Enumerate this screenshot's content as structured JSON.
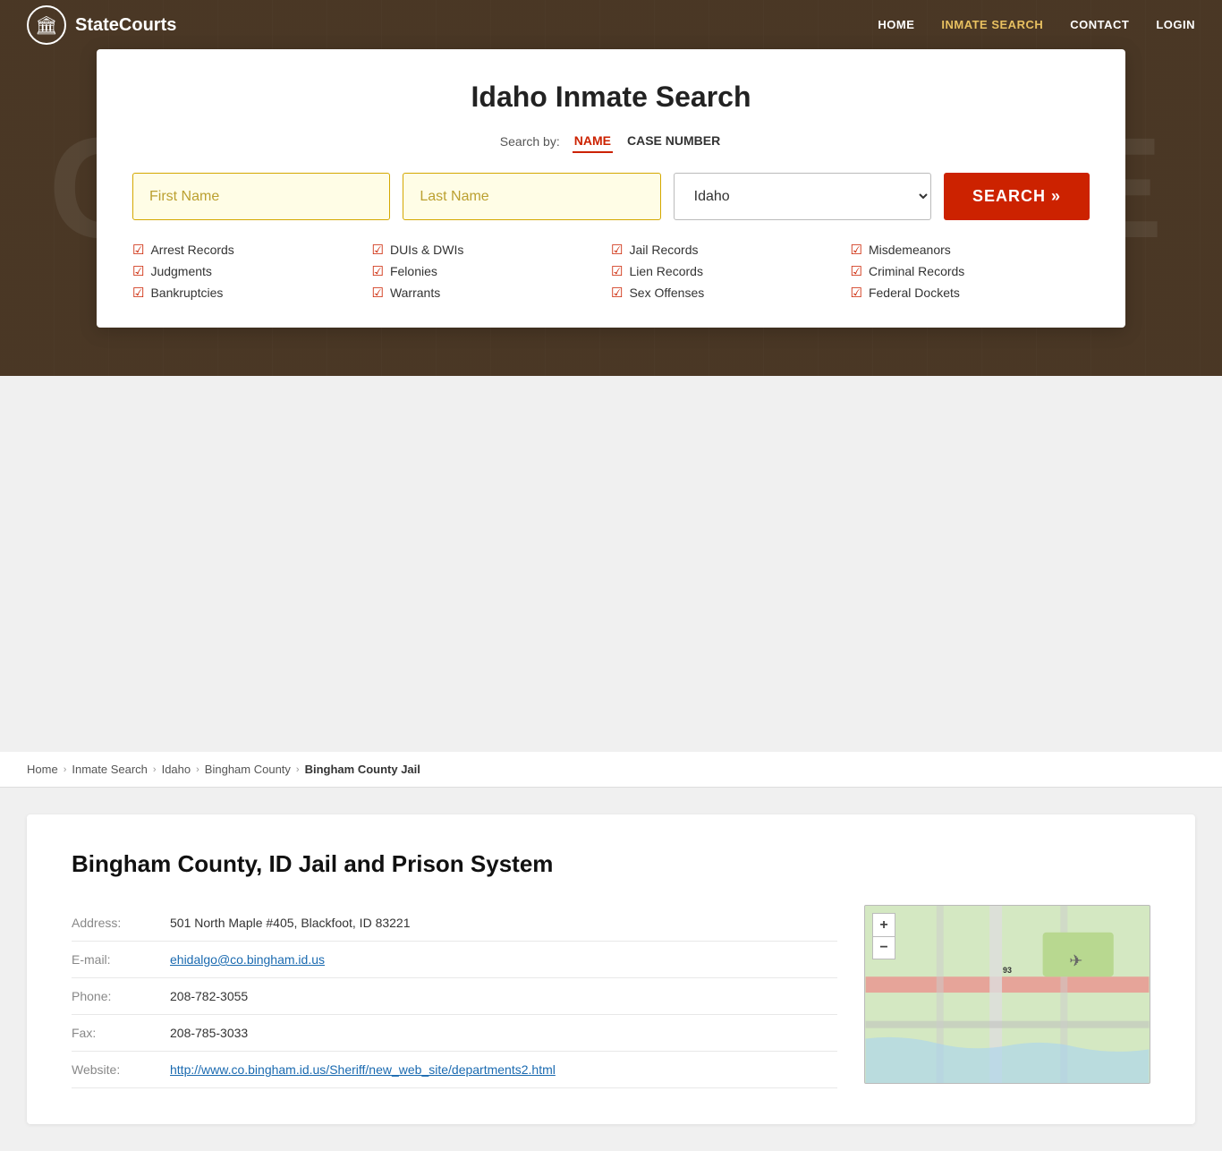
{
  "nav": {
    "logo_text": "StateCourts",
    "logo_icon": "🏛",
    "links": [
      {
        "label": "HOME",
        "href": "#",
        "active": false
      },
      {
        "label": "INMATE SEARCH",
        "href": "#",
        "active": true
      },
      {
        "label": "CONTACT",
        "href": "#",
        "active": false
      },
      {
        "label": "LOGIN",
        "href": "#",
        "active": false
      }
    ]
  },
  "hero": {
    "bg_text": "COURTHOUSE"
  },
  "search_card": {
    "title": "Idaho Inmate Search",
    "search_by_label": "Search by:",
    "tabs": [
      {
        "label": "NAME",
        "active": true
      },
      {
        "label": "CASE NUMBER",
        "active": false
      }
    ],
    "first_name_placeholder": "First Name",
    "last_name_placeholder": "Last Name",
    "state_value": "Idaho",
    "search_button": "SEARCH »",
    "checkboxes": [
      {
        "label": "Arrest Records"
      },
      {
        "label": "DUIs & DWIs"
      },
      {
        "label": "Jail Records"
      },
      {
        "label": "Misdemeanors"
      },
      {
        "label": "Judgments"
      },
      {
        "label": "Felonies"
      },
      {
        "label": "Lien Records"
      },
      {
        "label": "Criminal Records"
      },
      {
        "label": "Bankruptcies"
      },
      {
        "label": "Warrants"
      },
      {
        "label": "Sex Offenses"
      },
      {
        "label": "Federal Dockets"
      }
    ]
  },
  "breadcrumb": {
    "items": [
      {
        "label": "Home",
        "href": "#"
      },
      {
        "label": "Inmate Search",
        "href": "#"
      },
      {
        "label": "Idaho",
        "href": "#"
      },
      {
        "label": "Bingham County",
        "href": "#"
      },
      {
        "label": "Bingham County Jail",
        "current": true
      }
    ]
  },
  "content": {
    "title": "Bingham County, ID Jail and Prison System",
    "fields": [
      {
        "label": "Address:",
        "value": "501 North Maple #405, Blackfoot, ID 83221",
        "type": "text"
      },
      {
        "label": "E-mail:",
        "value": "ehidalgo@co.bingham.id.us",
        "type": "link"
      },
      {
        "label": "Phone:",
        "value": "208-782-3055",
        "type": "text"
      },
      {
        "label": "Fax:",
        "value": "208-785-3033",
        "type": "text"
      },
      {
        "label": "Website:",
        "value": "http://www.co.bingham.id.us/Sheriff/new_web_site/departments2.html",
        "type": "link"
      }
    ]
  },
  "map": {
    "zoom_in": "+",
    "zoom_out": "−"
  }
}
